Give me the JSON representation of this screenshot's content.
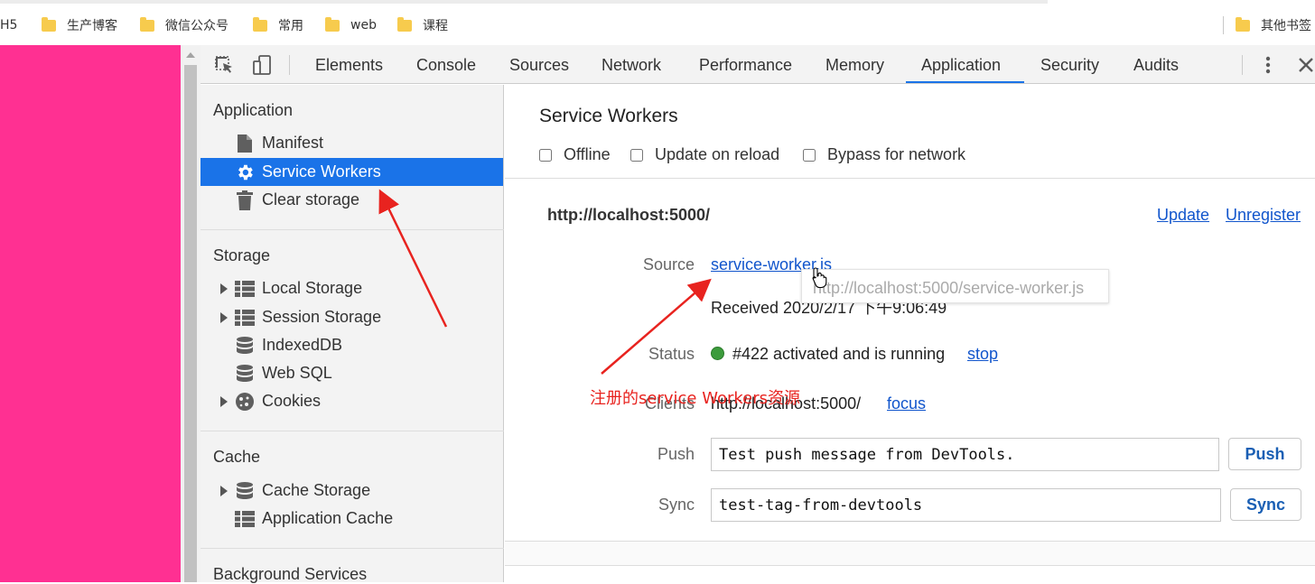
{
  "bookmarks": {
    "items": [
      {
        "label": "H5",
        "folder": false
      },
      {
        "label": "生产博客",
        "folder": true
      },
      {
        "label": "微信公众号",
        "folder": true
      },
      {
        "label": "常用",
        "folder": true
      },
      {
        "label": "web",
        "folder": true
      },
      {
        "label": "课程",
        "folder": true
      }
    ],
    "other": "其他书签"
  },
  "page": {
    "background_color": "#ff3092"
  },
  "devtools": {
    "tabs": [
      "Elements",
      "Console",
      "Sources",
      "Network",
      "Performance",
      "Memory",
      "Application",
      "Security",
      "Audits"
    ],
    "active_tab": "Application",
    "icons": {
      "inspect": "inspect-element-icon",
      "device": "device-toolbar-icon",
      "menu": "more-vertical-icon",
      "close": "close-icon"
    },
    "accent_color": "#1a73e8"
  },
  "sidebar": {
    "sections": [
      {
        "title": "Application",
        "items": [
          {
            "label": "Manifest",
            "icon": "file-icon",
            "expandable": false
          },
          {
            "label": "Service Workers",
            "icon": "gear-icon",
            "expandable": false,
            "selected": true
          },
          {
            "label": "Clear storage",
            "icon": "trash-icon",
            "expandable": false
          }
        ]
      },
      {
        "title": "Storage",
        "items": [
          {
            "label": "Local Storage",
            "icon": "grid-icon",
            "expandable": true
          },
          {
            "label": "Session Storage",
            "icon": "grid-icon",
            "expandable": true
          },
          {
            "label": "IndexedDB",
            "icon": "database-icon",
            "expandable": false
          },
          {
            "label": "Web SQL",
            "icon": "database-icon",
            "expandable": false
          },
          {
            "label": "Cookies",
            "icon": "cookie-icon",
            "expandable": true
          }
        ]
      },
      {
        "title": "Cache",
        "items": [
          {
            "label": "Cache Storage",
            "icon": "database-icon",
            "expandable": true
          },
          {
            "label": "Application Cache",
            "icon": "grid-icon",
            "expandable": false
          }
        ]
      },
      {
        "title": "Background Services",
        "items": []
      }
    ]
  },
  "main": {
    "title": "Service Workers",
    "options": [
      {
        "label": "Offline",
        "checked": false
      },
      {
        "label": "Update on reload",
        "checked": false
      },
      {
        "label": "Bypass for network",
        "checked": false
      }
    ],
    "worker": {
      "origin": "http://localhost:5000/",
      "update_label": "Update",
      "unregister_label": "Unregister",
      "source_label": "Source",
      "source_link": "service-worker.js",
      "received": "Received 2020/2/17 下午9:06:49",
      "status_label": "Status",
      "status_text": "#422 activated and is running",
      "status_color": "#3c9b3c",
      "stop_label": "stop",
      "clients_label": "Clients",
      "clients_value": "http://localhost:5000/",
      "focus_label": "focus",
      "push_label": "Push",
      "push_value": "Test push message from DevTools.",
      "push_button": "Push",
      "sync_label": "Sync",
      "sync_value": "test-tag-from-devtools",
      "sync_button": "Sync"
    }
  },
  "tooltip": {
    "text": "http://localhost:5000/service-worker.js"
  },
  "annotation": {
    "text": "注册的service Workers资源",
    "color": "#e8231f"
  }
}
